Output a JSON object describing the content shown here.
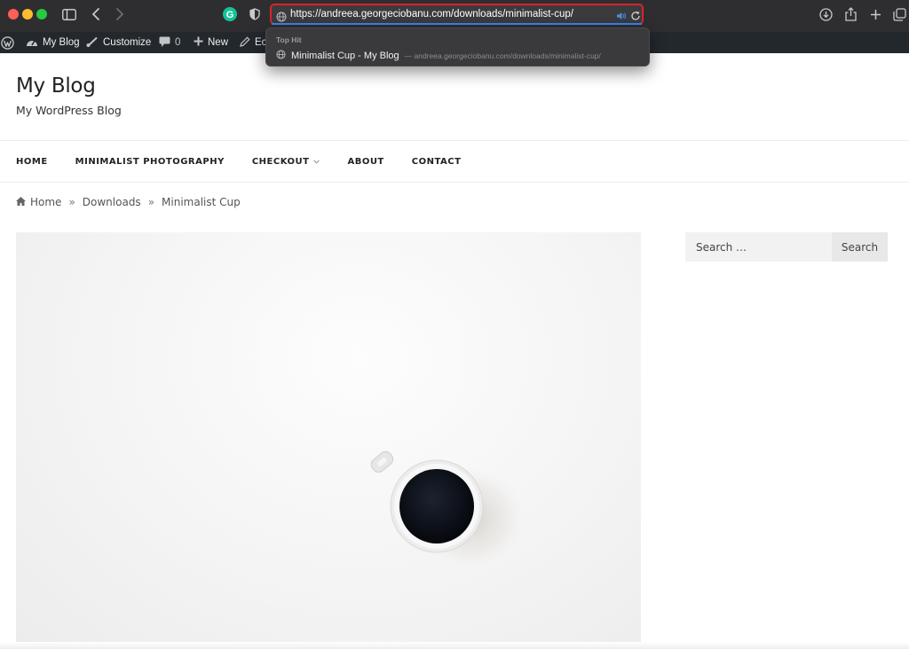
{
  "browser": {
    "url": "https://andreea.georgeciobanu.com/downloads/minimalist-cup/",
    "icons": [
      "sidebar-icon",
      "back-icon",
      "forward-icon",
      "grammarly-icon",
      "shield-icon",
      "globe-icon",
      "speaker-icon",
      "reload-icon",
      "download-icon",
      "share-icon",
      "plus-icon",
      "tabs-icon"
    ]
  },
  "suggestion": {
    "heading": "Top Hit",
    "title": "Minimalist Cup - My Blog",
    "subtitle": "— andreea.georgeciobanu.com/downloads/minimalist-cup/"
  },
  "adminbar": {
    "site": "My Blog",
    "customize": "Customize",
    "comments": "0",
    "new": "New",
    "edit_partial": "Ec"
  },
  "site": {
    "title": "My Blog",
    "tagline": "My WordPress Blog"
  },
  "nav": {
    "items": [
      "HOME",
      "MINIMALIST PHOTOGRAPHY",
      "CHECKOUT",
      "ABOUT",
      "CONTACT"
    ]
  },
  "breadcrumb": {
    "home": "Home",
    "separator": "»",
    "downloads": "Downloads",
    "current": "Minimalist Cup"
  },
  "sidebar": {
    "search_placeholder": "Search …",
    "search_button": "Search"
  },
  "colors": {
    "toolbar": "#2e2e30",
    "url_highlight": "#d6252b",
    "adminbar": "#23282d",
    "grammarly": "#15c39a"
  }
}
